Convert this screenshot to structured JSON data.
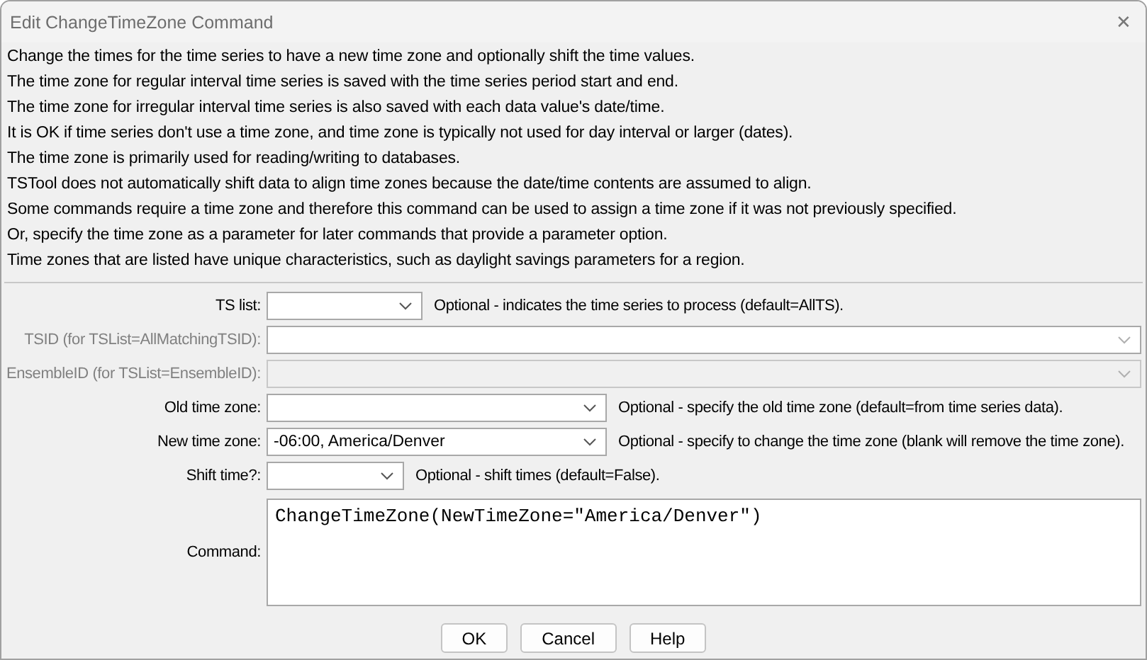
{
  "window": {
    "title": "Edit ChangeTimeZone Command",
    "close": "✕"
  },
  "description": [
    "Change the times for the time series to have a new time zone and optionally shift the time values.",
    "The time zone for regular interval time series is saved with the time series period start and end.",
    "The time zone for irregular interval time series is also saved with each data value's date/time.",
    "It is OK if time series don't use a time zone, and time zone is typically not used for day interval or larger (dates).",
    "The time zone is primarily used for reading/writing to databases.",
    "TSTool does not automatically shift data to align time zones because the date/time contents are assumed to align.",
    "Some commands require a time zone and therefore this command can be used to assign a time zone if it was not previously specified.",
    "Or, specify the time zone as a parameter for later commands that provide a parameter option.",
    "Time zones that are listed have unique characteristics, such as daylight savings parameters for a region."
  ],
  "parameters": [
    {
      "label": "TS list:",
      "kind": "narrow",
      "label_disabled": false,
      "field_disabled": false,
      "note": "Optional - indicates the time series to process (default=AllTS)."
    },
    {
      "label": "TSID (for TSList=AllMatchingTSID):",
      "kind": "wide",
      "label_disabled": true,
      "field_disabled": false
    },
    {
      "label": "EnsembleID (for TSList=EnsembleID):",
      "kind": "wide",
      "label_disabled": true,
      "field_disabled": true
    },
    {
      "label": "Old time zone:",
      "kind": "medium",
      "label_disabled": false,
      "field_disabled": false,
      "note": "Optional - specify the old time zone (default=from time series data)."
    },
    {
      "label": "New time zone:",
      "kind": "medium",
      "label_disabled": false,
      "field_disabled": false,
      "value": "-06:00, America/Denver",
      "note": "Optional - specify to change the time zone (blank will remove the time zone)."
    },
    {
      "label": "Shift time?:",
      "kind": "short",
      "label_disabled": false,
      "field_disabled": false,
      "note": "Optional - shift times (default=False)."
    }
  ],
  "command": {
    "label": "Command:",
    "value": "ChangeTimeZone(NewTimeZone=\"America/Denver\")"
  },
  "buttons": [
    "OK",
    "Cancel",
    "Help"
  ]
}
